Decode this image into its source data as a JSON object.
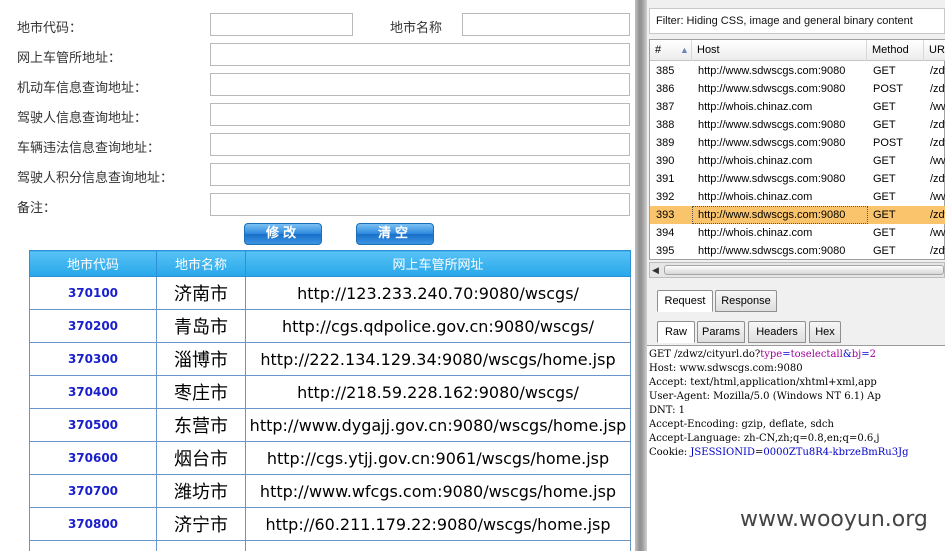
{
  "form": {
    "city_code_label": "地市代码：",
    "city_name_label": "地市名称",
    "portal_label": "网上车管所地址：",
    "vehicle_label": "机动车信息查询地址：",
    "driver_label": "驾驶人信息查询地址：",
    "violation_label": "车辆违法信息查询地址：",
    "points_label": "驾驶人积分信息查询地址：",
    "note_label": "备注：",
    "modify_button": "修改",
    "clear_button": "清空"
  },
  "table": {
    "headers": [
      "地市代码",
      "地市名称",
      "网上车管所网址"
    ],
    "rows": [
      {
        "code": "370100",
        "name": "济南市",
        "url": "http://123.233.240.70:9080/wscgs/"
      },
      {
        "code": "370200",
        "name": "青岛市",
        "url": "http://cgs.qdpolice.gov.cn:9080/wscgs/"
      },
      {
        "code": "370300",
        "name": "淄博市",
        "url": "http://222.134.129.34:9080/wscgs/home.jsp"
      },
      {
        "code": "370400",
        "name": "枣庄市",
        "url": "http://218.59.228.162:9080/wscgs/"
      },
      {
        "code": "370500",
        "name": "东营市",
        "url": "http://www.dygajj.gov.cn:9080/wscgs/home.jsp"
      },
      {
        "code": "370600",
        "name": "烟台市",
        "url": "http://cgs.ytjj.gov.cn:9061/wscgs/home.jsp"
      },
      {
        "code": "370700",
        "name": "潍坊市",
        "url": "http://www.wfcgs.com:9080/wscgs/home.jsp"
      },
      {
        "code": "370800",
        "name": "济宁市",
        "url": "http://60.211.179.22:9080/wscgs/home.jsp"
      }
    ]
  },
  "fiddler": {
    "filter_text": "Filter: Hiding CSS, image and general binary content",
    "columns": [
      "#",
      "Host",
      "Method",
      "URL"
    ],
    "sessions": [
      {
        "id": "385",
        "host": "http://www.sdwscgs.com:9080",
        "method": "GET",
        "url": "/zdw"
      },
      {
        "id": "386",
        "host": "http://www.sdwscgs.com:9080",
        "method": "POST",
        "url": "/zdw"
      },
      {
        "id": "387",
        "host": "http://whois.chinaz.com",
        "method": "GET",
        "url": "/ww"
      },
      {
        "id": "388",
        "host": "http://www.sdwscgs.com:9080",
        "method": "GET",
        "url": "/zdw"
      },
      {
        "id": "389",
        "host": "http://www.sdwscgs.com:9080",
        "method": "POST",
        "url": "/zdw"
      },
      {
        "id": "390",
        "host": "http://whois.chinaz.com",
        "method": "GET",
        "url": "/ww"
      },
      {
        "id": "391",
        "host": "http://www.sdwscgs.com:9080",
        "method": "GET",
        "url": "/zdw"
      },
      {
        "id": "392",
        "host": "http://whois.chinaz.com",
        "method": "GET",
        "url": "/ww"
      },
      {
        "id": "393",
        "host": "http://www.sdwscgs.com:9080",
        "method": "GET",
        "url": "/zdw",
        "selected": true
      },
      {
        "id": "394",
        "host": "http://whois.chinaz.com",
        "method": "GET",
        "url": "/ww"
      },
      {
        "id": "395",
        "host": "http://www.sdwscgs.com:9080",
        "method": "GET",
        "url": "/zdw"
      }
    ],
    "tabs_top": [
      "Request",
      "Response"
    ],
    "tabs_inspector": [
      "Raw",
      "Params",
      "Headers",
      "Hex"
    ],
    "raw": {
      "line1_prefix": "GET /zdwz/cityurl.do?",
      "line1_param": "type",
      "line1_eq": "=",
      "line1_value": "toselectall",
      "line1_amp": "&",
      "line1_param2": "bj",
      "line1_eq2": "=",
      "line1_value2": "2",
      "line2": "Host: www.sdwscgs.com:9080",
      "line3": "Accept: text/html,application/xhtml+xml,app",
      "line4": "User-Agent: Mozilla/5.0 (Windows NT 6.1) Ap",
      "line5": "DNT: 1",
      "line6": "Accept-Encoding: gzip, deflate, sdch",
      "line7": "Accept-Language: zh-CN,zh;q=0.8,en;q=0.6,j",
      "line8_prefix": "Cookie: ",
      "line8_key": "JSESSIONID",
      "line8_eq": "=",
      "line8_value": "0000ZTu8R4-kbrzeBmRu3Jg"
    }
  },
  "watermark": "www.wooyun.org"
}
